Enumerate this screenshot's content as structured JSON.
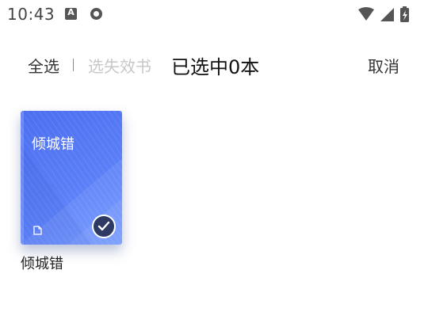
{
  "status_bar": {
    "time": "10:43",
    "notification_icons": [
      "a-box-icon",
      "circle-app-icon"
    ],
    "system_icons": [
      "wifi-icon",
      "cellular-signal-icon",
      "battery-charging-icon"
    ]
  },
  "toolbar": {
    "select_all": "全选",
    "select_invalid": "选失效书",
    "selected_count": "已选中0本",
    "cancel": "取消"
  },
  "books": [
    {
      "cover_title": "倾城错",
      "name": "倾城错",
      "selected": true
    }
  ],
  "colors": {
    "cover_start": "#4c6ef0",
    "cover_end": "#6b93ff",
    "check_badge": "#2e3a64",
    "disabled_text": "#c7c7c7"
  }
}
